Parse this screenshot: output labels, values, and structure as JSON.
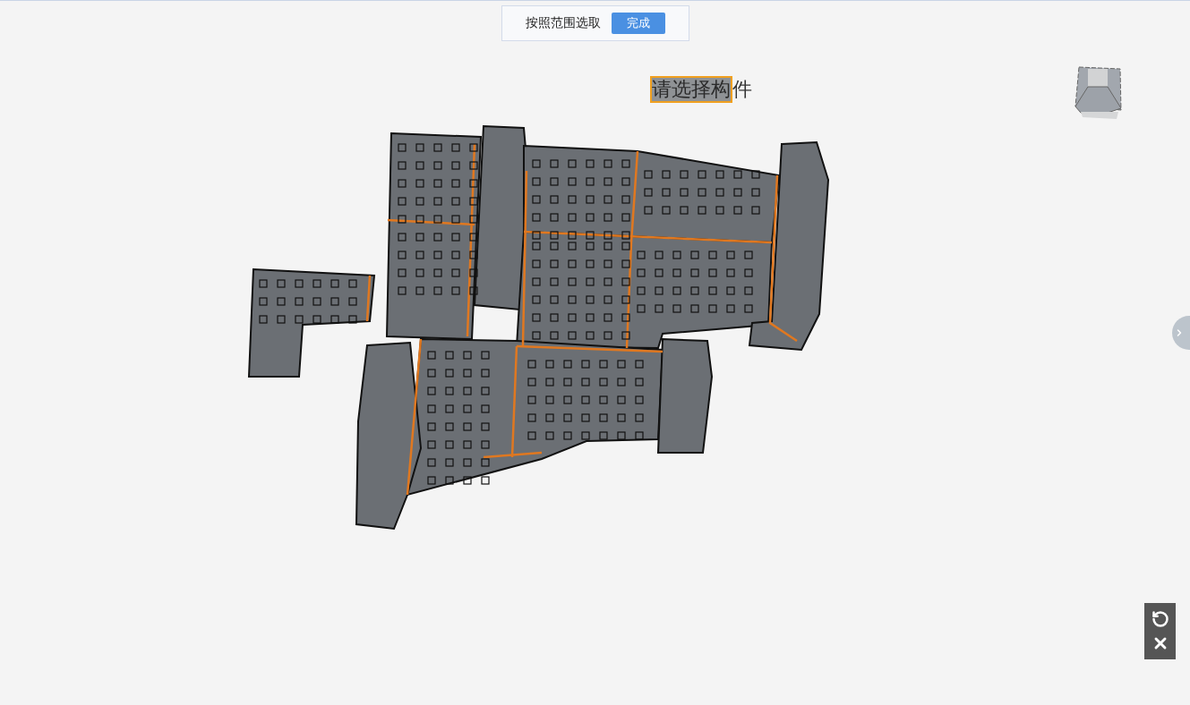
{
  "toolbar": {
    "label": "按照范围选取",
    "button": "完成"
  },
  "prompt": {
    "highlighted": "请选择构",
    "rest": "件"
  }
}
